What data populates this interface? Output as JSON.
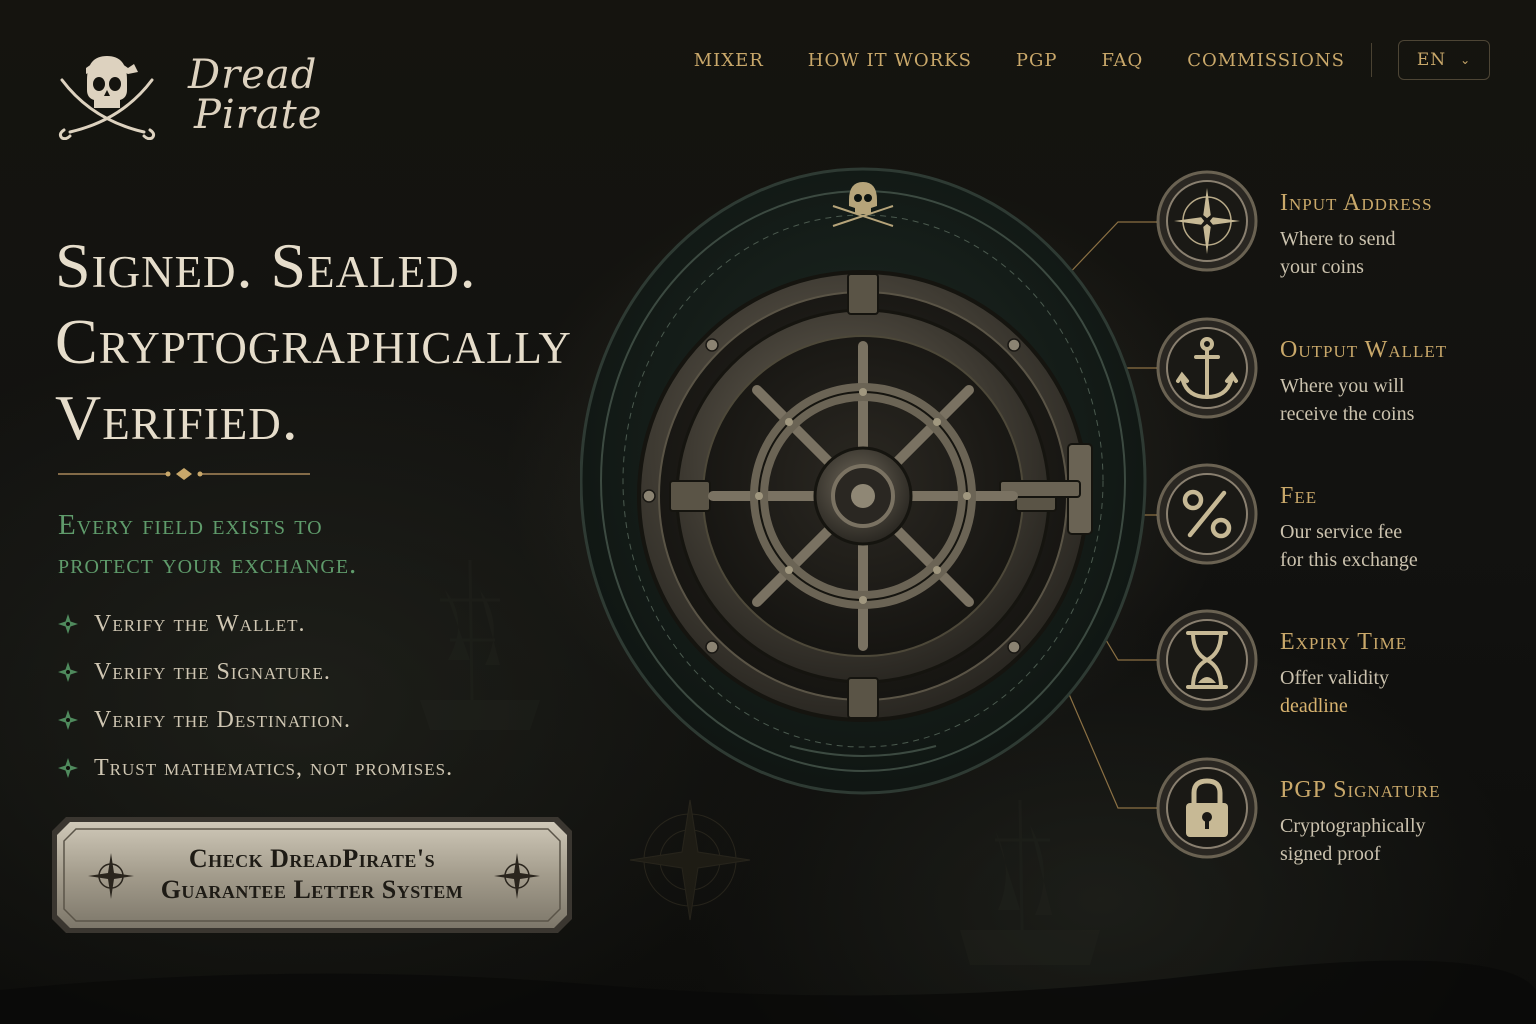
{
  "brand": {
    "name_line1": "Dread",
    "name_line2": "Pirate"
  },
  "nav": {
    "items": [
      {
        "label": "MIXER"
      },
      {
        "label": "HOW IT WORKS"
      },
      {
        "label": "PGP"
      },
      {
        "label": "FAQ"
      },
      {
        "label": "COMMISSIONS"
      }
    ],
    "language": "EN"
  },
  "hero": {
    "headline_lines": [
      "Signed. Sealed.",
      "Cryptographically",
      "Verified."
    ],
    "subhead_lines": [
      "Every field exists to",
      "protect your exchange."
    ],
    "bullets": [
      "Verify the Wallet.",
      "Verify the Signature.",
      "Verify the Destination.",
      "Trust mathematics, not promises."
    ],
    "cta_lines": [
      "Check DreadPirate's",
      "Guarantee Letter System"
    ]
  },
  "features": [
    {
      "title": "Input Address",
      "desc_line1": "Where to send",
      "desc_line2": "your coins",
      "icon": "compass-icon"
    },
    {
      "title": "Output Wallet",
      "desc_line1": "Where you will",
      "desc_line2": "receive the coins",
      "icon": "anchor-icon"
    },
    {
      "title": "Fee",
      "desc_line1": "Our service fee",
      "desc_line2": "for this exchange",
      "icon": "percent-icon"
    },
    {
      "title": "Expiry Time",
      "desc_line1": "Offer validity",
      "desc_line2": "deadline",
      "icon": "hourglass-icon"
    },
    {
      "title": "PGP Signature",
      "desc_line1": "Cryptographically",
      "desc_line2": "signed proof",
      "icon": "padlock-icon"
    }
  ],
  "colors": {
    "gold": "#c9a86a",
    "green": "#5f9b6b",
    "cream": "#e6ddcb",
    "background": "#0f0e0b"
  }
}
